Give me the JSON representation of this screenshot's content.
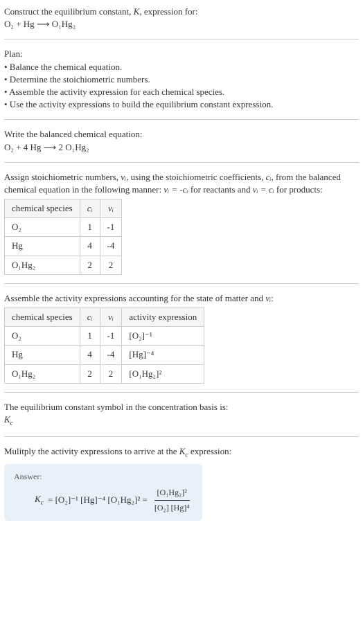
{
  "intro": {
    "line1": "Construct the equilibrium constant, ",
    "k": "K",
    "line1b": ", expression for:",
    "eq": "O₂ + Hg ⟶ O₁Hg₂"
  },
  "plan": {
    "title": "Plan:",
    "b1": "• Balance the chemical equation.",
    "b2": "• Determine the stoichiometric numbers.",
    "b3": "• Assemble the activity expression for each chemical species.",
    "b4": "• Use the activity expressions to build the equilibrium constant expression."
  },
  "balanced": {
    "title": "Write the balanced chemical equation:",
    "eq": "O₂ + 4 Hg ⟶ 2 O₁Hg₂"
  },
  "assign": {
    "text1": "Assign stoichiometric numbers, ",
    "vi": "νᵢ",
    "text2": ", using the stoichiometric coefficients, ",
    "ci": "cᵢ",
    "text3": ", from the balanced chemical equation in the following manner: ",
    "rel1": "νᵢ = -cᵢ",
    "text4": " for reactants and ",
    "rel2": "νᵢ = cᵢ",
    "text5": " for products:"
  },
  "table1": {
    "h1": "chemical species",
    "h2": "cᵢ",
    "h3": "νᵢ",
    "r1c1": "O₂",
    "r1c2": "1",
    "r1c3": "-1",
    "r2c1": "Hg",
    "r2c2": "4",
    "r2c3": "-4",
    "r3c1": "O₁Hg₂",
    "r3c2": "2",
    "r3c3": "2"
  },
  "assemble": {
    "text1": "Assemble the activity expressions accounting for the state of matter and ",
    "vi": "νᵢ",
    "text2": ":"
  },
  "table2": {
    "h1": "chemical species",
    "h2": "cᵢ",
    "h3": "νᵢ",
    "h4": "activity expression",
    "r1c1": "O₂",
    "r1c2": "1",
    "r1c3": "-1",
    "r1c4": "[O₂]⁻¹",
    "r2c1": "Hg",
    "r2c2": "4",
    "r2c3": "-4",
    "r2c4": "[Hg]⁻⁴",
    "r3c1": "O₁Hg₂",
    "r3c2": "2",
    "r3c3": "2",
    "r3c4": "[O₁Hg₂]²"
  },
  "symbol": {
    "text": "The equilibrium constant symbol in the concentration basis is:",
    "kc": "K",
    "kcsub": "c"
  },
  "multiply": {
    "text1": "Mulitply the activity expressions to arrive at the ",
    "kc": "K",
    "kcsub": "c",
    "text2": " expression:"
  },
  "answer": {
    "label": "Answer:",
    "lhs_k": "K",
    "lhs_sub": "c",
    "mid": " = [O₂]⁻¹ [Hg]⁻⁴ [O₁Hg₂]² = ",
    "num": "[O₁Hg₂]²",
    "den": "[O₂] [Hg]⁴"
  }
}
